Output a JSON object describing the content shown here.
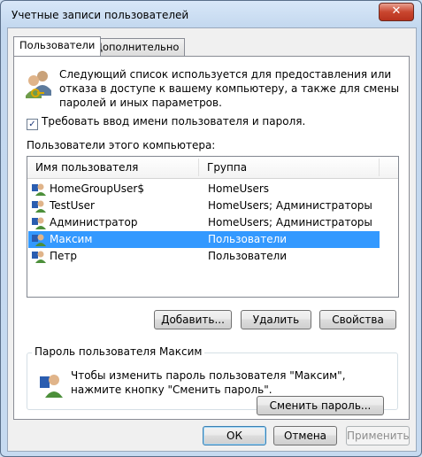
{
  "window": {
    "title": "Учетные записи пользователей",
    "close_glyph": "✕"
  },
  "tabs": [
    {
      "label": "Пользователи"
    },
    {
      "label": "Дополнительно"
    }
  ],
  "description": "Следующий список используется для предоставления или отказа в доступе к вашему компьютеру, а также для смены паролей и иных параметров.",
  "require_login": {
    "label": "Требовать ввод имени пользователя и пароля.",
    "checked": true
  },
  "users_list": {
    "label": "Пользователи этого компьютера:",
    "columns": [
      "Имя пользователя",
      "Группа"
    ],
    "rows": [
      {
        "name": "HomeGroupUser$",
        "group": "HomeUsers",
        "selected": false
      },
      {
        "name": "TestUser",
        "group": "HomeUsers; Администраторы",
        "selected": false
      },
      {
        "name": "Администратор",
        "group": "HomeUsers; Администраторы",
        "selected": false
      },
      {
        "name": "Максим",
        "group": "Пользователи",
        "selected": true
      },
      {
        "name": "Петр",
        "group": "Пользователи",
        "selected": false
      }
    ]
  },
  "list_buttons": {
    "add": "Добавить...",
    "remove": "Удалить",
    "properties": "Свойства"
  },
  "password_group": {
    "title": "Пароль пользователя Максим",
    "text": "Чтобы изменить пароль пользователя \"Максим\", нажмите кнопку \"Сменить пароль\".",
    "button": "Сменить пароль..."
  },
  "dialog_buttons": {
    "ok": "ОК",
    "cancel": "Отмена",
    "apply": "Применить"
  },
  "colors": {
    "selection": "#3399ff",
    "title_bar": "#c3d8ef",
    "close_button": "#c9462f"
  },
  "icons": {
    "users": "users-icon",
    "user": "user-icon",
    "password_user": "user-key-icon"
  }
}
